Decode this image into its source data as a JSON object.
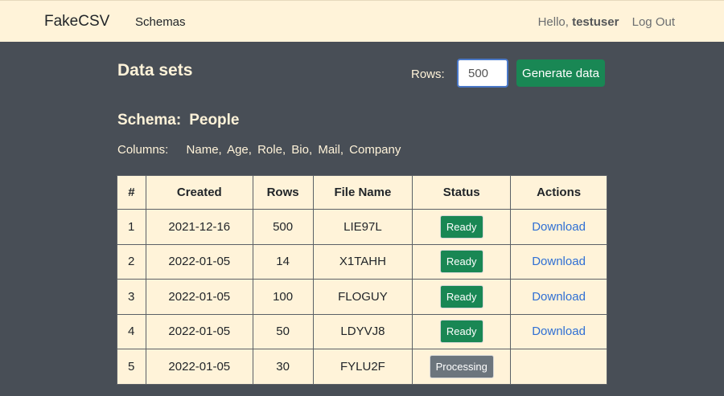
{
  "navbar": {
    "brand": "FakeCSV",
    "schemas_link": "Schemas",
    "greeting": "Hello,",
    "username": "testuser",
    "logout": "Log Out"
  },
  "page": {
    "title": "Data sets",
    "rows_label": "Rows:",
    "rows_value": "500",
    "generate_button": "Generate data"
  },
  "schema": {
    "label": "Schema:",
    "name": "People",
    "columns_label": "Columns:",
    "columns": [
      "Name,",
      "Age,",
      "Role,",
      "Bio,",
      "Mail,",
      "Company"
    ]
  },
  "table": {
    "headers": [
      "#",
      "Created",
      "Rows",
      "File Name",
      "Status",
      "Actions"
    ],
    "rows": [
      {
        "num": "1",
        "created": "2021-12-16",
        "rows": "500",
        "file": "LIE97L",
        "status": "Ready",
        "action": "Download"
      },
      {
        "num": "2",
        "created": "2022-01-05",
        "rows": "14",
        "file": "X1TAHH",
        "status": "Ready",
        "action": "Download"
      },
      {
        "num": "3",
        "created": "2022-01-05",
        "rows": "100",
        "file": "FLOGUY",
        "status": "Ready",
        "action": "Download"
      },
      {
        "num": "4",
        "created": "2022-01-05",
        "rows": "50",
        "file": "LDYVJ8",
        "status": "Ready",
        "action": "Download"
      },
      {
        "num": "5",
        "created": "2022-01-05",
        "rows": "30",
        "file": "FYLU2F",
        "status": "Processing",
        "action": ""
      }
    ]
  },
  "colors": {
    "background": "#484e56",
    "navbar": "#fff3d9",
    "success": "#198754",
    "secondary": "#6c757d",
    "link": "#2f6fd4"
  }
}
